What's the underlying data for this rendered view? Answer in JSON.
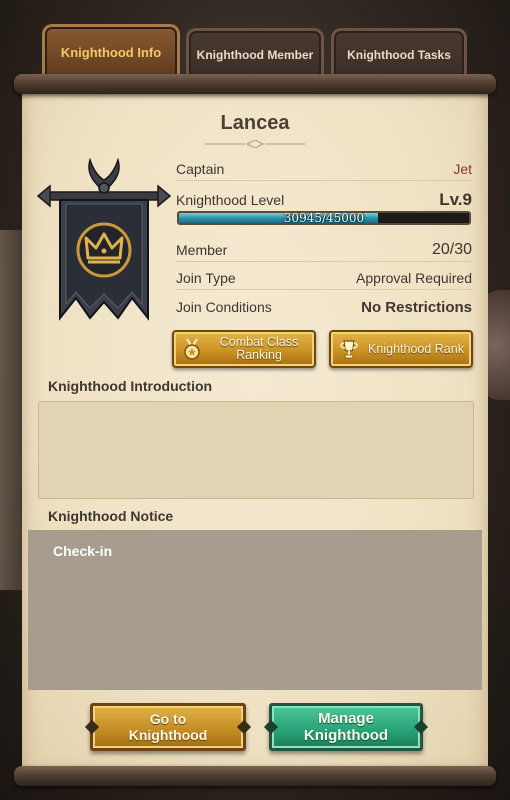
{
  "tabs": [
    {
      "label": "Knighthood Info",
      "active": true
    },
    {
      "label": "Knighthood Member",
      "active": false
    },
    {
      "label": "Knighthood Tasks",
      "active": false
    }
  ],
  "knighthood": {
    "name": "Lancea",
    "emblem_icon": "crown-banner-icon"
  },
  "info": {
    "captain_label": "Captain",
    "captain_value": "Jet",
    "level_label": "Knighthood Level",
    "level_value": "Lv.9",
    "progress_text": "30945/45000",
    "progress_fraction": 0.6877,
    "member_label": "Member",
    "member_value": "20/30",
    "join_type_label": "Join Type",
    "join_type_value": "Approval Required",
    "join_conditions_label": "Join Conditions",
    "join_conditions_value": "No Restrictions"
  },
  "buttons": {
    "combat_ranking": "Combat Class Ranking",
    "combat_ranking_icon": "medal-icon",
    "knighthood_rank": "Knighthood Rank",
    "knighthood_rank_icon": "trophy-icon",
    "go_to": "Go to Knighthood",
    "manage": "Manage Knighthood"
  },
  "sections": {
    "introduction_title": "Knighthood Introduction",
    "introduction_text": "",
    "notice_title": "Knighthood Notice",
    "notice_text": "Check-in"
  },
  "colors": {
    "active_tab_text": "#f5c766",
    "captain_name": "#8a3a22",
    "progress_fill": "#2a8ea6",
    "gold_button": "#c98f20",
    "green_button": "#27a276"
  }
}
